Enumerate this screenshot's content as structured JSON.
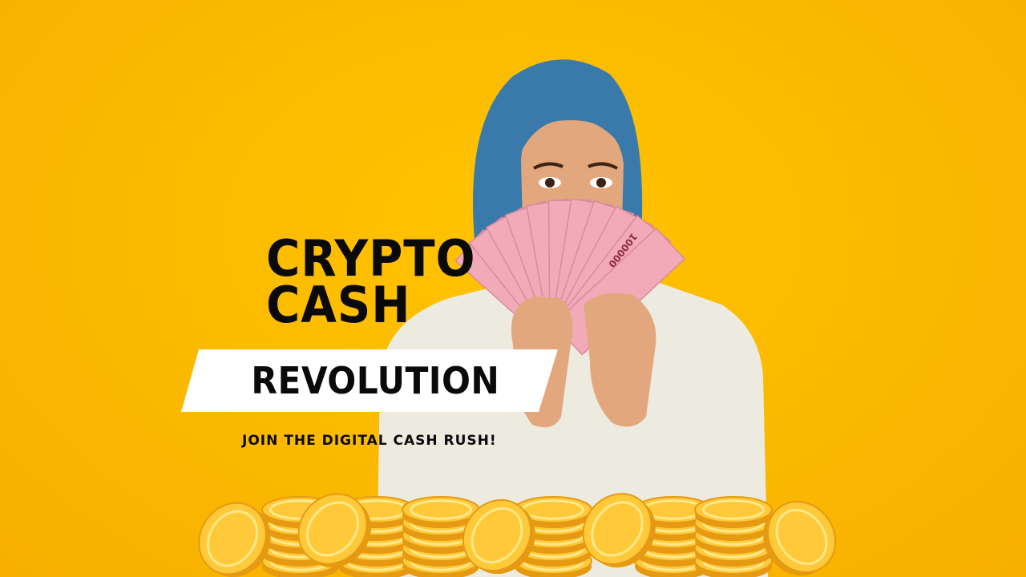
{
  "colors": {
    "background_center": "#FFC300",
    "background_edge": "#F7B000",
    "headline_text": "#0A0A0A",
    "banner_fill": "#FFFFFF",
    "hijab": "#3A7AAA",
    "skin": "#E3A77E",
    "sweater": "#EDEBE0",
    "banknote": "#F2AAB8",
    "coin_gold": "#FFC93A",
    "coin_shade": "#E69A12",
    "coin_highlight": "#FFE98A"
  },
  "graphic": {
    "title_line_1": "CRYPTO",
    "title_line_2": "CASH",
    "banner_text": "REVOLUTION",
    "tagline": "JOIN THE DIGITAL CASH RUSH!"
  },
  "photo": {
    "subject": "woman-in-blue-hijab-fanning-banknotes",
    "banknote_denomination": "100000"
  }
}
